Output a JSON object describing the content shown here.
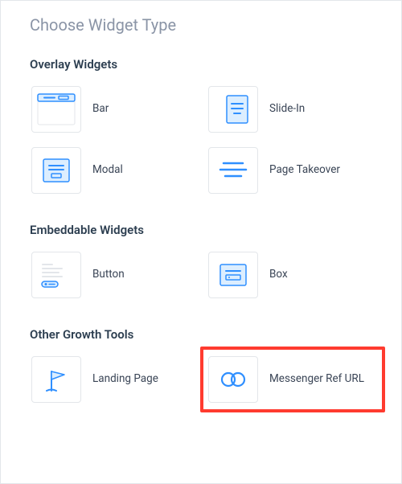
{
  "title": "Choose Widget Type",
  "sections": {
    "overlay": {
      "title": "Overlay Widgets",
      "items": {
        "bar": "Bar",
        "slidein": "Slide-In",
        "modal": "Modal",
        "takeover": "Page Takeover"
      }
    },
    "embeddable": {
      "title": "Embeddable Widgets",
      "items": {
        "button": "Button",
        "box": "Box"
      }
    },
    "other": {
      "title": "Other Growth Tools",
      "items": {
        "landing": "Landing Page",
        "refurl": "Messenger Ref URL"
      }
    }
  }
}
